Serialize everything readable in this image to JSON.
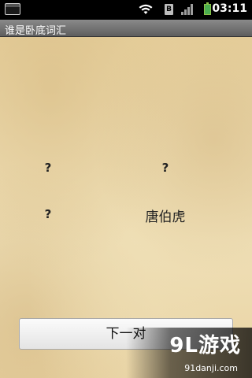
{
  "status_bar": {
    "time": "03:11",
    "icons": [
      "screenshot-icon",
      "wifi-icon",
      "sim-icon",
      "signal-icon",
      "battery-icon"
    ],
    "sim_glyph": "B"
  },
  "title_bar": {
    "title": "谁是卧底词汇"
  },
  "words": [
    {
      "text": "?"
    },
    {
      "text": "?"
    },
    {
      "text": "?"
    },
    {
      "text": "唐伯虎"
    }
  ],
  "next_button": {
    "label": "下一对"
  },
  "watermark": {
    "logo": "9L游戏",
    "url": "91danji.com"
  },
  "colors": {
    "parchment": "#ecd9ad",
    "title_bar": "#6f6f6f",
    "button_bg": "#f2f2f2"
  }
}
